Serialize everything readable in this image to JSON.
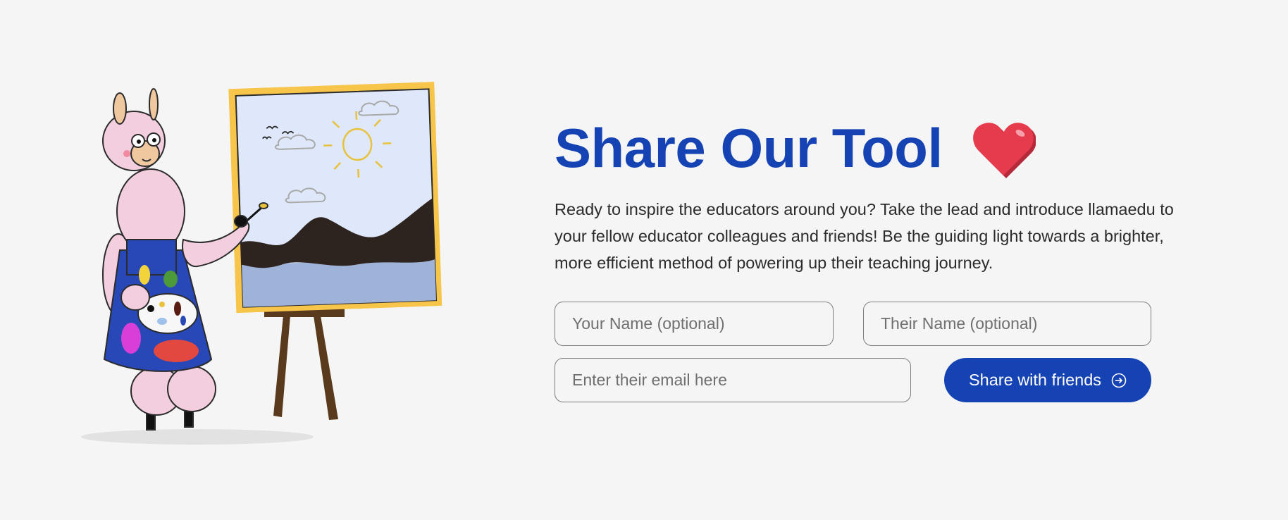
{
  "section": {
    "title": "Share Our Tool",
    "description": "Ready to inspire the educators around you? Take the lead and introduce llamaedu to your fellow educator colleagues and friends! Be the guiding light towards a brighter, more efficient method of powering up their teaching journey."
  },
  "form": {
    "your_name_placeholder": "Your Name (optional)",
    "their_name_placeholder": "Their Name (optional)",
    "email_placeholder": "Enter their email here",
    "share_label": "Share with friends"
  },
  "icons": {
    "heart": "heart-icon",
    "share": "arrow-circle-right-icon"
  },
  "colors": {
    "accent": "#1643b4",
    "heart": "#e63a4d",
    "background": "#f5f5f5",
    "frame": "#f6c54a"
  }
}
